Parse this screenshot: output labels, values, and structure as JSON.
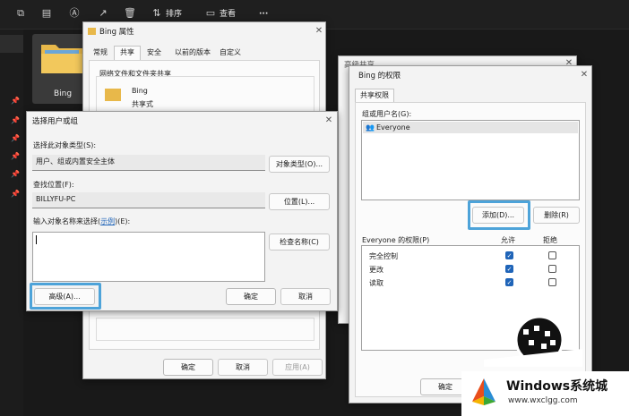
{
  "explorer": {
    "sort_label": "排序",
    "view_label": "查看",
    "more_label": "···",
    "folder_name": "Bing"
  },
  "props": {
    "title": "Bing 属性",
    "tabs": [
      "常规",
      "共享",
      "安全",
      "以前的版本",
      "自定义"
    ],
    "section_title": "网络文件和文件夹共享",
    "folder_name": "Bing",
    "share_status": "共享式",
    "ok": "确定",
    "cancel": "取消",
    "apply": "应用(A)"
  },
  "advshare": {
    "title": "高级共享",
    "ok": "确定"
  },
  "perm": {
    "title": "Bing 的权限",
    "tab": "共享权限",
    "group_label": "组或用户名(G):",
    "user": "Everyone",
    "add": "添加(D)...",
    "remove": "删除(R)",
    "perm_header": "Everyone 的权限(P)",
    "allow": "允许",
    "deny": "拒绝",
    "rows": [
      {
        "name": "完全控制",
        "allow": true,
        "deny": false
      },
      {
        "name": "更改",
        "allow": true,
        "deny": false
      },
      {
        "name": "读取",
        "allow": true,
        "deny": false
      }
    ]
  },
  "select": {
    "title": "选择用户或组",
    "type_label": "选择此对象类型(S):",
    "type_value": "用户、组或内置安全主体",
    "type_button": "对象类型(O)...",
    "loc_label": "查找位置(F):",
    "loc_value": "BILLYFU-PC",
    "loc_button": "位置(L)...",
    "input_label_pre": "输入对象名称来选择(",
    "input_label_link": "示例",
    "input_label_post": ")(E):",
    "check_button": "检查名称(C)",
    "advanced_button": "高级(A)...",
    "ok": "确定",
    "cancel": "取消"
  },
  "watermark": {
    "brand": "Windows系统城",
    "url": "www.wxclgg.com"
  },
  "colors": {
    "highlight": "#4da3d9",
    "checkbox": "#1f64b8"
  }
}
